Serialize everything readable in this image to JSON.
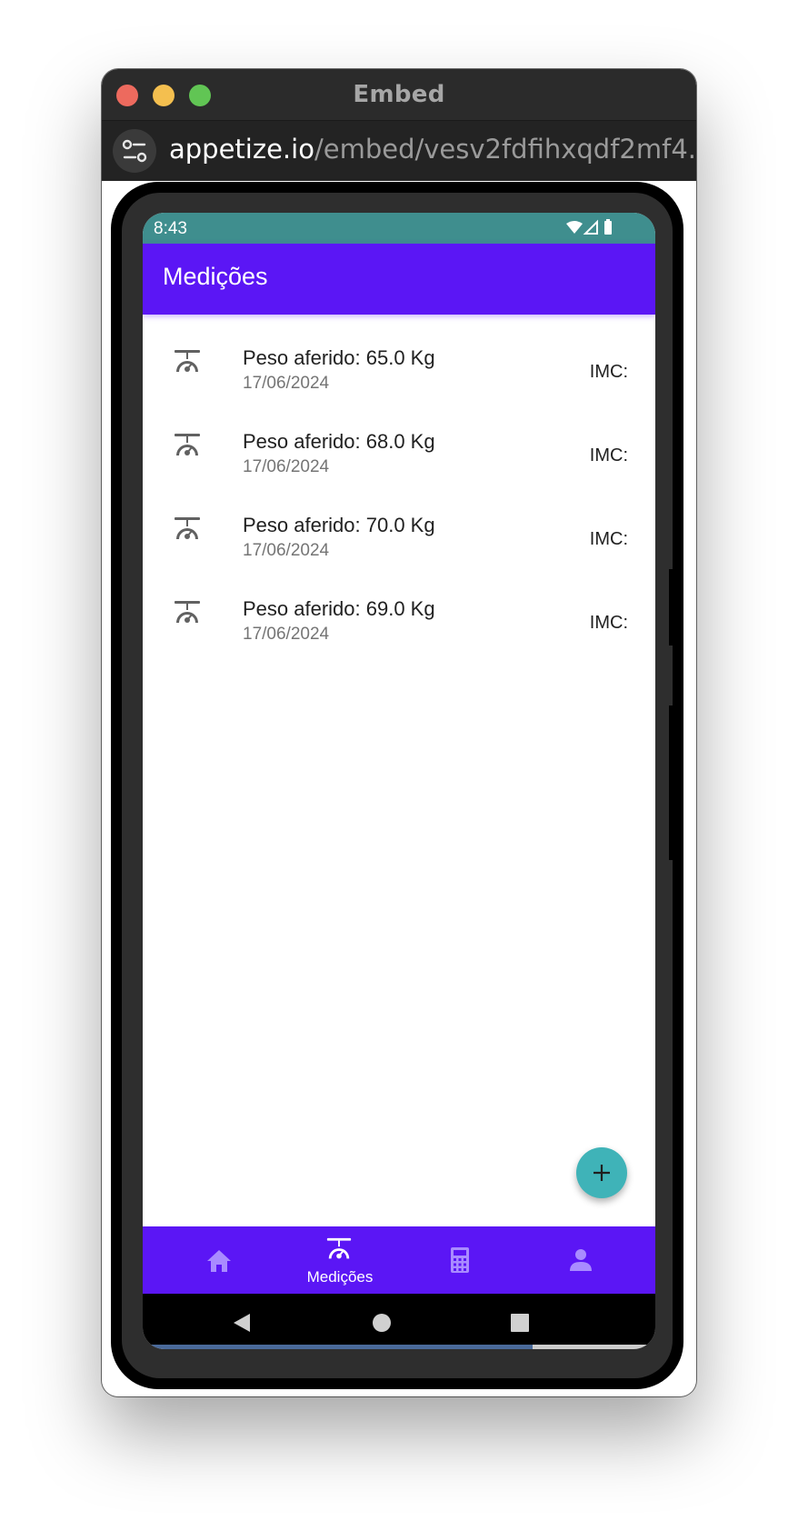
{
  "window": {
    "title": "Embed",
    "url_host": "appetize.io",
    "url_path": "/embed/vesv2fdfihxqdf2mf4..."
  },
  "status_bar": {
    "time": "8:43",
    "icons": [
      "wifi-icon",
      "cell-signal-icon",
      "battery-icon"
    ]
  },
  "app_bar": {
    "title": "Medições"
  },
  "measurements": [
    {
      "title": "Peso aferido: 65.0 Kg",
      "date": "17/06/2024",
      "imc": "IMC:",
      "icon": "scale-icon"
    },
    {
      "title": "Peso aferido: 68.0 Kg",
      "date": "17/06/2024",
      "imc": "IMC:",
      "icon": "scale-icon"
    },
    {
      "title": "Peso aferido: 70.0 Kg",
      "date": "17/06/2024",
      "imc": "IMC:",
      "icon": "scale-icon"
    },
    {
      "title": "Peso aferido: 69.0 Kg",
      "date": "17/06/2024",
      "imc": "IMC:",
      "icon": "scale-icon"
    }
  ],
  "fab": {
    "icon": "plus-icon"
  },
  "bottom_nav": {
    "items": [
      {
        "icon": "home-icon",
        "label": "",
        "active": false
      },
      {
        "icon": "scale-icon",
        "label": "Medições",
        "active": true
      },
      {
        "icon": "calculator-icon",
        "label": "",
        "active": false
      },
      {
        "icon": "person-icon",
        "label": "",
        "active": false
      }
    ]
  },
  "system_nav": {
    "icons": [
      "back-icon",
      "home-circle-icon",
      "recents-icon"
    ]
  },
  "load_progress": 0.76,
  "colors": {
    "app_bar": "#5b16f5",
    "status_bar": "#3f8e8e",
    "fab": "#3fb3b8",
    "inactive_nav_icon": "#a98bff"
  }
}
